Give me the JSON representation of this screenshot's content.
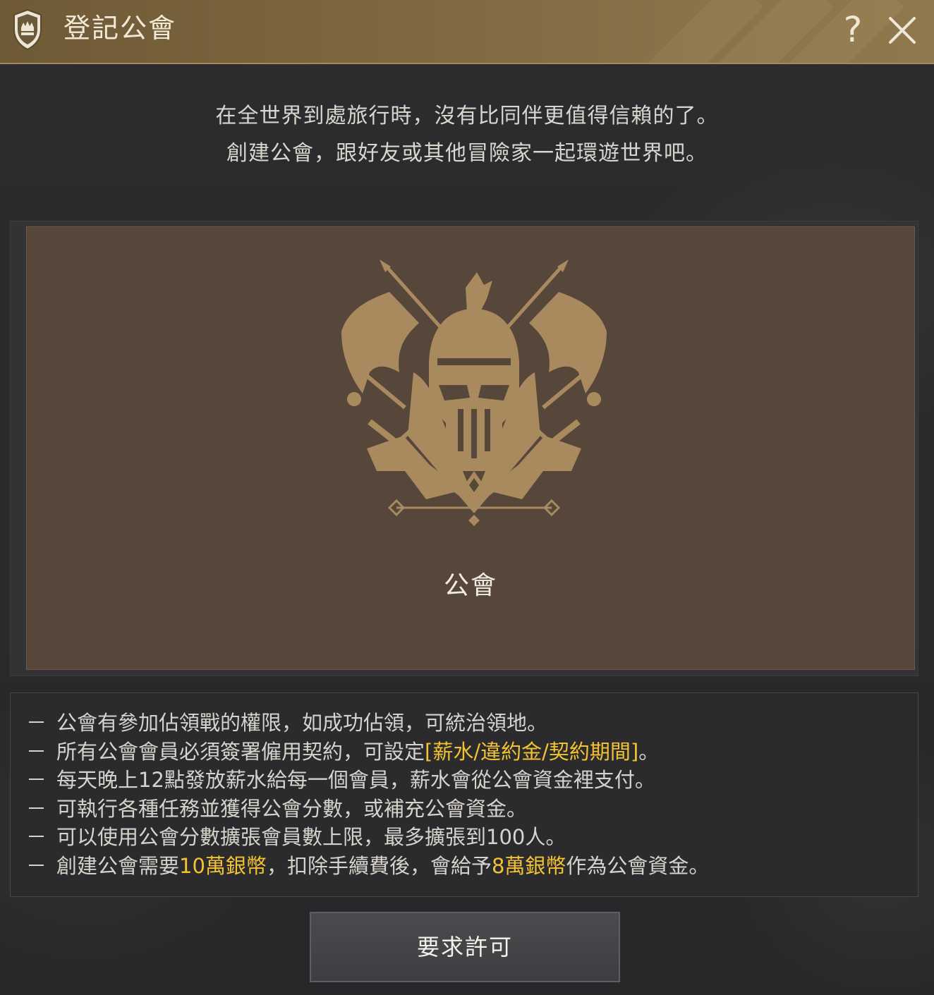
{
  "window": {
    "title": "登記公會",
    "help_label": "?"
  },
  "intro": {
    "line1": "在全世界到處旅行時，沒有比同伴更值得信賴的了。",
    "line2": "創建公會，跟好友或其他冒險家一起環遊世界吧。"
  },
  "card": {
    "label": "公會"
  },
  "info": {
    "items": [
      {
        "text": "公會有參加佔領戰的權限，如成功佔領，可統治領地。"
      },
      {
        "pre": "所有公會會員必須簽署僱用契約，可設定",
        "hl": "[薪水/違約金/契約期間]",
        "post": "。"
      },
      {
        "text": "每天晚上12點發放薪水給每一個會員，薪水會從公會資金裡支付。"
      },
      {
        "text": "可執行各種任務並獲得公會分數，或補充公會資金。"
      },
      {
        "text": "可以使用公會分數擴張會員數上限，最多擴張到100人。"
      },
      {
        "pre": "創建公會需要",
        "hl": "10萬銀幣",
        "mid": "，扣除手續費後，會給予",
        "hl2": "8萬銀幣",
        "post": "作為公會資金。"
      }
    ],
    "dash": "－"
  },
  "button": {
    "label": "要求許可"
  },
  "colors": {
    "titlebar": "#7d6740",
    "card_bg": "#57473b",
    "emblem": "#a88a5e",
    "highlight": "#f2c233"
  }
}
